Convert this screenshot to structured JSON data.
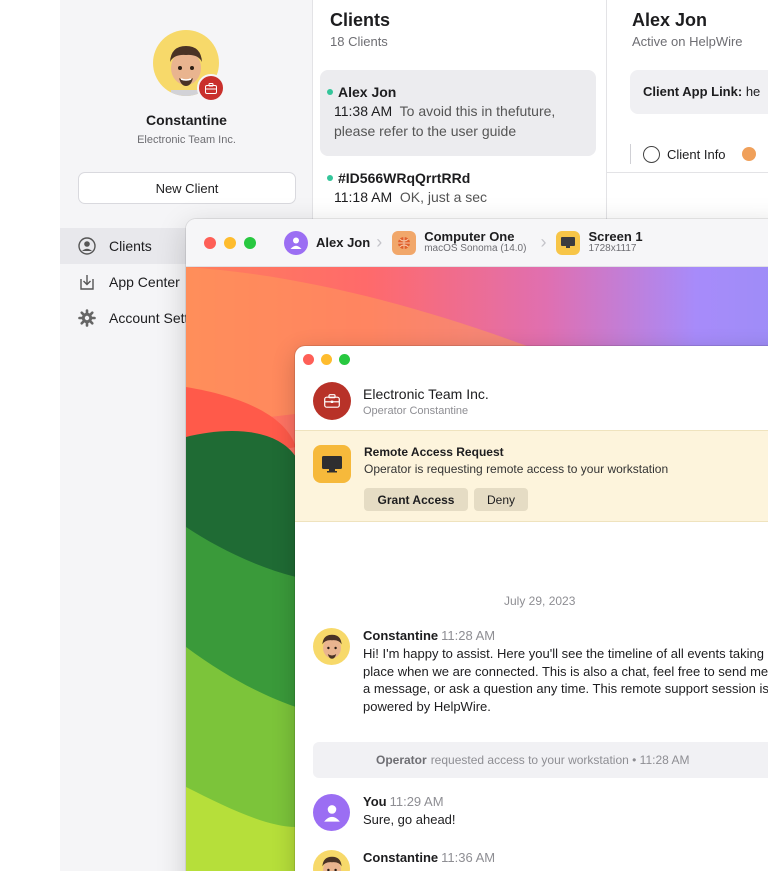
{
  "sidebar": {
    "profile_name": "Constantine",
    "profile_org": "Electronic Team Inc.",
    "new_client_label": "New Client",
    "items": [
      {
        "label": "Clients",
        "icon": "person-circle-icon",
        "active": true
      },
      {
        "label": "App Center",
        "icon": "download-box-icon",
        "active": false
      },
      {
        "label": "Account Settings",
        "icon": "gear-icon",
        "active": false
      }
    ]
  },
  "clients": {
    "title": "Clients",
    "count": "18 Clients",
    "list": [
      {
        "name": "Alex Jon",
        "time": "11:38 AM",
        "preview": "To avoid this in thefuture, please refer to the user guide",
        "online": true,
        "selected": true
      },
      {
        "name": "#ID566WRqQrrtRRd",
        "time": "11:18 AM",
        "preview": "OK, just a sec",
        "online": true,
        "selected": false
      }
    ]
  },
  "detail": {
    "name": "Alex Jon",
    "status": "Active on HelpWire",
    "link_label": "Client App Link:",
    "link_value": "he",
    "tab_client_info": "Client Info"
  },
  "remote": {
    "user": "Alex Jon",
    "computer_name": "Computer One",
    "computer_os": "macOS Sonoma (14.0)",
    "screen_name": "Screen 1",
    "screen_res": "1728x1117"
  },
  "chat": {
    "org_name": "Electronic Team Inc.",
    "operator": "Operator Constantine",
    "request": {
      "title": "Remote Access Request",
      "text": "Operator is requesting remote access to your workstation",
      "grant_label": "Grant Access",
      "deny_label": "Deny"
    },
    "date": "July 29, 2023",
    "messages": [
      {
        "author": "Constantine",
        "time": "11:28 AM",
        "text": "Hi! I'm happy to assist. Here you'll see the timeline of all events taking place when we are connected. This is also a chat, feel free to send me a message, or ask a question any time. This remote support session is powered by HelpWire."
      },
      {
        "author": "You",
        "time": "11:29 AM",
        "text": "Sure, go ahead!"
      },
      {
        "author": "Constantine",
        "time": "11:36 AM",
        "text": ""
      }
    ],
    "system": {
      "actor": "Operator",
      "text": "requested access to your workstation • 11:28 AM"
    }
  },
  "colors": {
    "online_dot": "#34c59a",
    "brand_red": "#c9302c",
    "request_bg": "#fdf4dc",
    "you_avatar": "#9b6ef3"
  }
}
